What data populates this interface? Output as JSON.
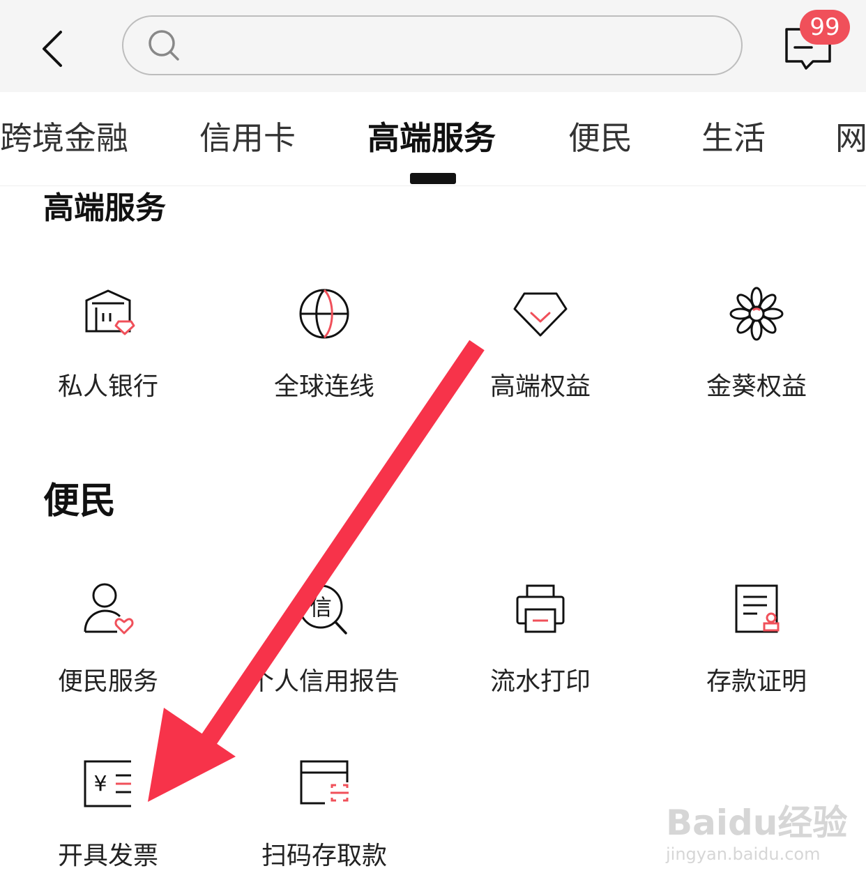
{
  "colors": {
    "accent": "#f0505a",
    "arrow": "#f7334a",
    "icon_stroke": "#111111"
  },
  "header": {
    "search_placeholder": "",
    "badge_count": "99"
  },
  "tabs": [
    {
      "label": "跨境金融",
      "active": false
    },
    {
      "label": "信用卡",
      "active": false
    },
    {
      "label": "高端服务",
      "active": true
    },
    {
      "label": "便民",
      "active": false
    },
    {
      "label": "生活",
      "active": false
    },
    {
      "label": "网",
      "active": false
    }
  ],
  "sections": {
    "premium": {
      "title": "高端服务",
      "items": [
        {
          "label": "私人银行",
          "icon": "bank-icon"
        },
        {
          "label": "全球连线",
          "icon": "globe-icon"
        },
        {
          "label": "高端权益",
          "icon": "diamond-icon"
        },
        {
          "label": "金葵权益",
          "icon": "flower-icon"
        }
      ]
    },
    "convenience": {
      "title": "便民",
      "items": [
        {
          "label": "便民服务",
          "icon": "user-heart-icon"
        },
        {
          "label": "个人信用报告",
          "icon": "credit-search-icon"
        },
        {
          "label": "流水打印",
          "icon": "printer-icon"
        },
        {
          "label": "存款证明",
          "icon": "certificate-icon"
        },
        {
          "label": "开具发票",
          "icon": "invoice-icon"
        },
        {
          "label": "扫码存取款",
          "icon": "scan-card-icon"
        }
      ]
    }
  },
  "watermark": {
    "brand": "Baidu经验",
    "url": "jingyan.baidu.com"
  }
}
